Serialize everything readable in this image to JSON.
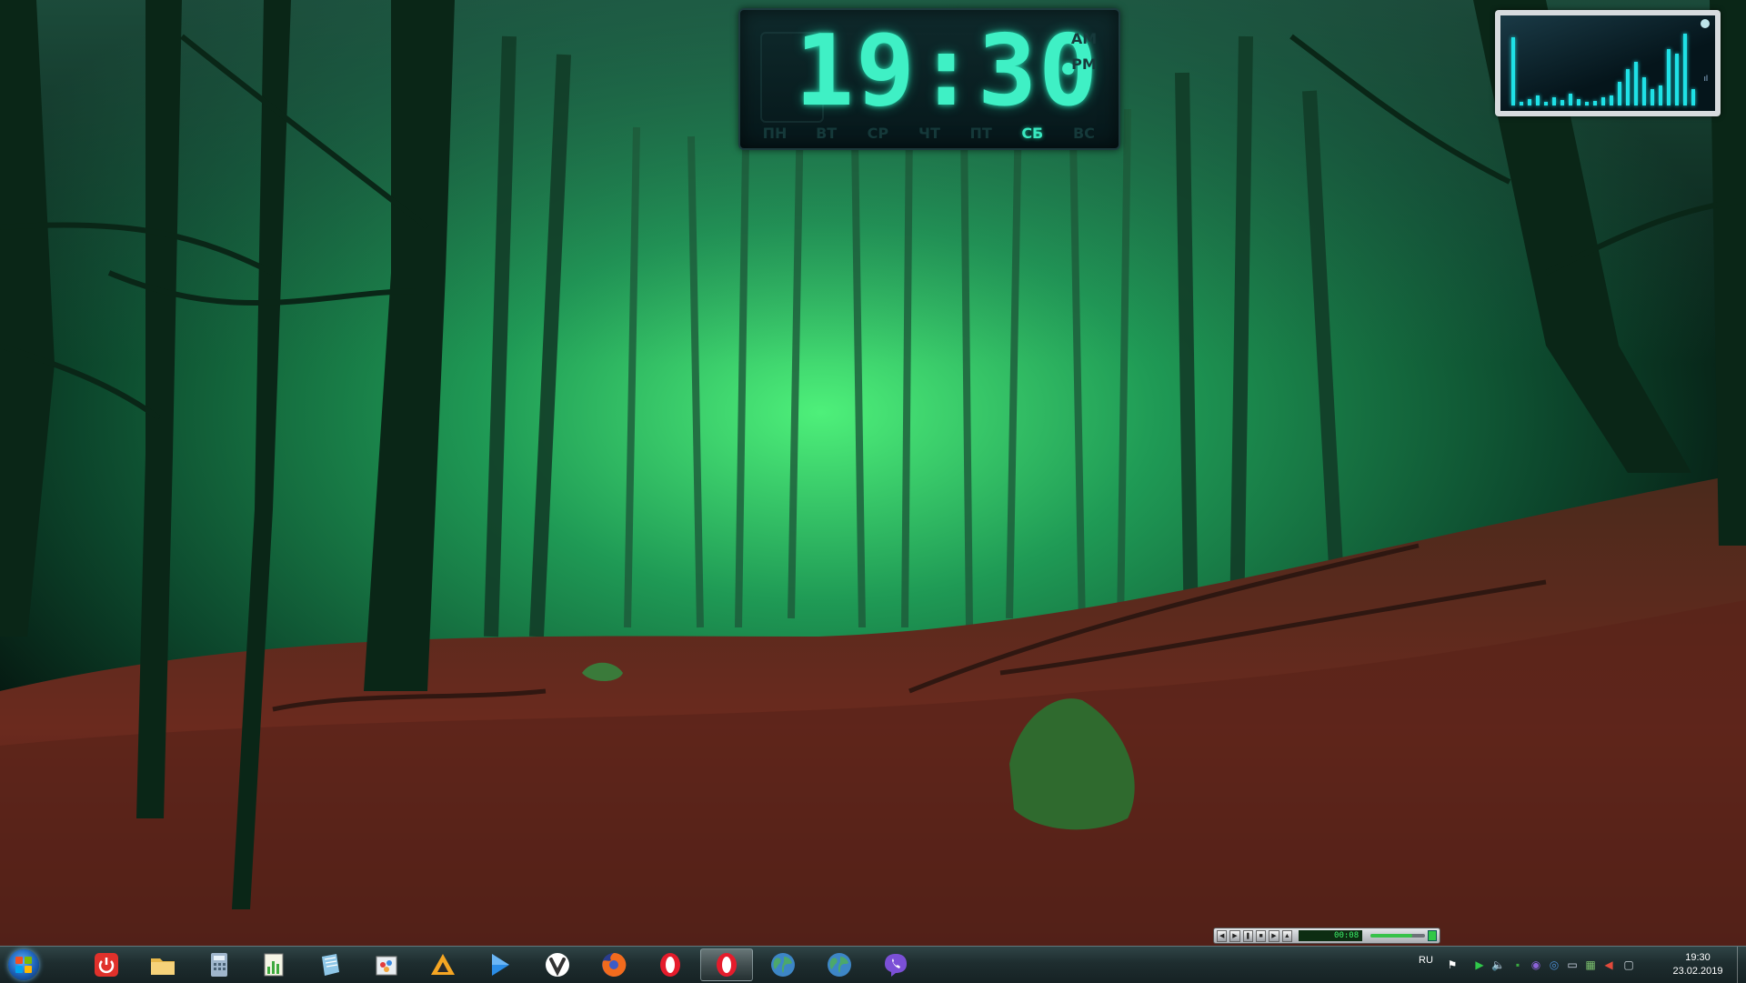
{
  "desktop": {
    "wallpaper": "green-misty-forest-with-red-leaves"
  },
  "clock_gadget": {
    "time": "19:30",
    "am_label": "AM",
    "pm_label": "PM",
    "days": [
      "ПН",
      "ВТ",
      "СР",
      "ЧТ",
      "ПТ",
      "СБ",
      "ВС"
    ],
    "active_day": "СБ",
    "accent_color": "#3ff0c5"
  },
  "meter_gadget": {
    "name": "audio-level-meter",
    "color": "#1fe1e6",
    "levels": [
      0.85,
      0.05,
      0.08,
      0.12,
      0.05,
      0.1,
      0.07,
      0.15,
      0.08,
      0.05,
      0.06,
      0.1,
      0.12,
      0.3,
      0.45,
      0.55,
      0.35,
      0.2,
      0.25,
      0.7,
      0.65,
      0.9,
      0.2
    ],
    "tiny_label": "ıl"
  },
  "mini_player": {
    "time": "00:08",
    "buttons": [
      "prev",
      "play",
      "pause",
      "stop",
      "next",
      "open"
    ]
  },
  "taskbar": {
    "start_icon": "windows-orb-icon",
    "apps": [
      {
        "name": "shutdown-app",
        "icon": "power-icon",
        "color": "#e0312b"
      },
      {
        "name": "file-explorer",
        "icon": "folder-icon",
        "color": "#e8b84a"
      },
      {
        "name": "calculator",
        "icon": "calculator-icon",
        "color": "#9fb6cc"
      },
      {
        "name": "task-manager",
        "icon": "chart-notepad-icon",
        "color": "#3faa3f"
      },
      {
        "name": "notepad",
        "icon": "notepad-icon",
        "color": "#8fc7e8"
      },
      {
        "name": "paint",
        "icon": "paint-icon",
        "color": "#f3a53b"
      },
      {
        "name": "aimp-player",
        "icon": "aimp-triangle-icon",
        "color": "#f5a623"
      },
      {
        "name": "media-player",
        "icon": "play-icon",
        "color": "#2b8de6"
      },
      {
        "name": "vivaldi-browser",
        "icon": "vivaldi-icon",
        "color": "#ef3939"
      },
      {
        "name": "firefox-browser",
        "icon": "firefox-icon",
        "color": "#f26b1d"
      },
      {
        "name": "opera-browser",
        "icon": "opera-icon",
        "color": "#e51c2c"
      },
      {
        "name": "opera-browser-2",
        "icon": "opera-icon",
        "color": "#e51c2c"
      },
      {
        "name": "network-globe",
        "icon": "globe-icon",
        "color": "#4ca86b"
      },
      {
        "name": "network-globe-2",
        "icon": "globe-icon",
        "color": "#4ca86b"
      },
      {
        "name": "viber-app",
        "icon": "viber-icon",
        "color": "#7b50d6"
      }
    ],
    "active_app_index": 11
  },
  "tray": {
    "language": "RU",
    "icons": [
      "flag-icon",
      "play-circle-icon",
      "speaker-icon",
      "media-icon",
      "viber-tray-icon",
      "globe-tray-icon",
      "keyboard-icon",
      "network-icon",
      "volume-icon",
      "notification-icon"
    ],
    "time": "19:30",
    "date": "23.02.2019"
  }
}
